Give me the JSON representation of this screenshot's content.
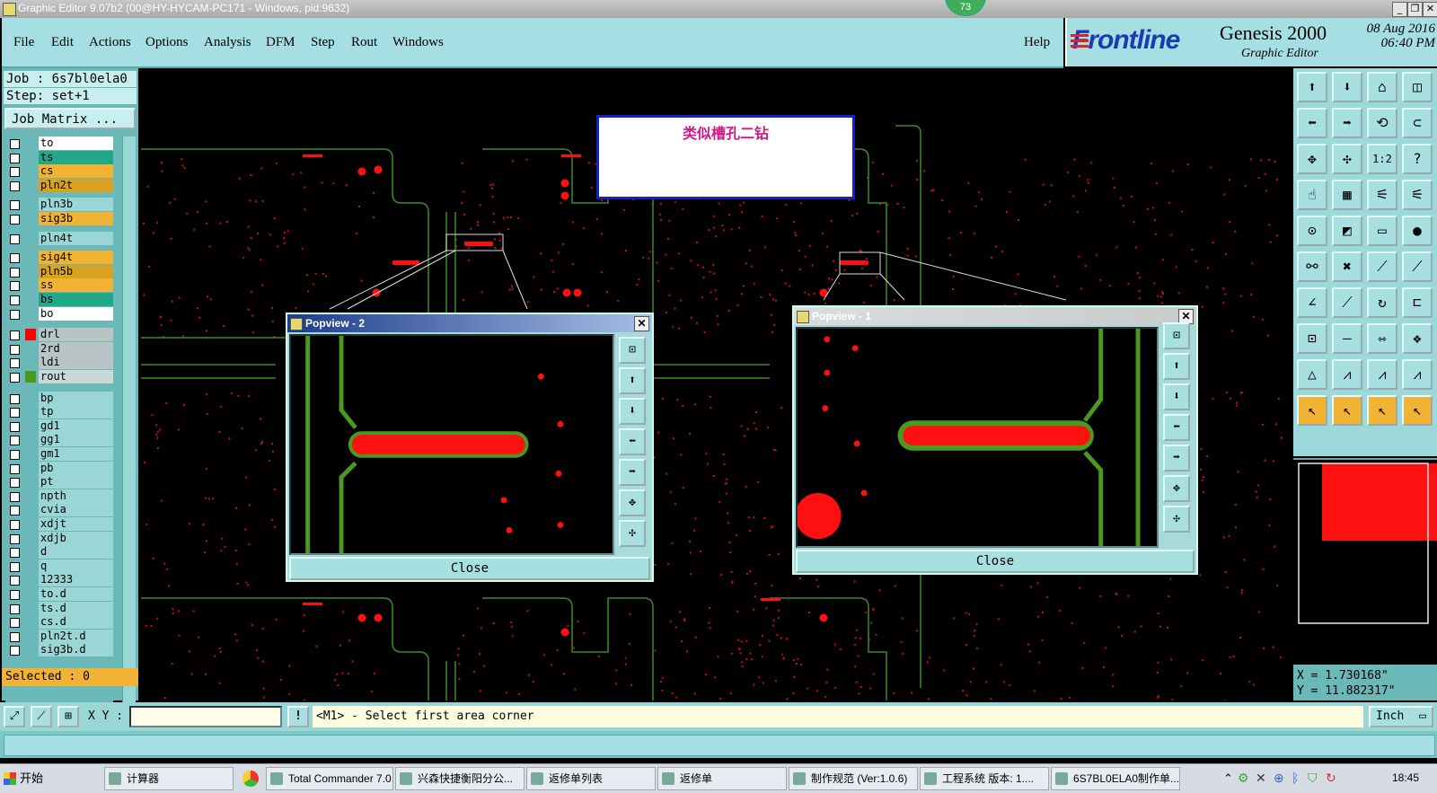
{
  "window": {
    "title": "Graphic Editor 9.07b2 (00@HY-HYCAM-PC171 - Windows, pid:9632)",
    "badge": "73"
  },
  "menu": [
    "File",
    "Edit",
    "Actions",
    "Options",
    "Analysis",
    "DFM",
    "Step",
    "Rout",
    "Windows"
  ],
  "help": "Help",
  "brand": {
    "logo": "Frontline",
    "product": "Genesis 2000",
    "subtitle": "Graphic Editor",
    "date": "08 Aug 2016",
    "time": "06:40 PM"
  },
  "job": {
    "job_label": "Job : 6s7bl0ela0",
    "step_label": "Step: set+1",
    "matrix_button": "Job Matrix ..."
  },
  "layers": [
    {
      "name": "to",
      "color": "#ffffff",
      "swatch": ""
    },
    {
      "name": "ts",
      "color": "#1fa88a",
      "swatch": ""
    },
    {
      "name": "cs",
      "color": "#f2b233",
      "swatch": ""
    },
    {
      "name": "pln2t",
      "color": "#d9a21e",
      "swatch": ""
    },
    {
      "name": "pln3b",
      "color": "#9ad6d6",
      "swatch": ""
    },
    {
      "name": "sig3b",
      "color": "#f2b233",
      "swatch": ""
    },
    {
      "name": "pln4t",
      "color": "#9ad6d6",
      "swatch": ""
    },
    {
      "name": "sig4t",
      "color": "#f2b233",
      "swatch": ""
    },
    {
      "name": "pln5b",
      "color": "#d9a21e",
      "swatch": ""
    },
    {
      "name": "ss",
      "color": "#f2b233",
      "swatch": ""
    },
    {
      "name": "bs",
      "color": "#1fa88a",
      "swatch": ""
    },
    {
      "name": "bo",
      "color": "#ffffff",
      "swatch": ""
    },
    {
      "name": "drl",
      "color": "#b9c4c4",
      "swatch": "#ff0000"
    },
    {
      "name": "2rd",
      "color": "#b9c4c4",
      "swatch": ""
    },
    {
      "name": "ldi",
      "color": "#b9c4c4",
      "swatch": ""
    },
    {
      "name": "rout",
      "color": "#c9d8d8",
      "swatch": "#4a9a20"
    },
    {
      "name": "bp",
      "color": "#9ad6d6",
      "swatch": ""
    },
    {
      "name": "tp",
      "color": "#9ad6d6",
      "swatch": ""
    },
    {
      "name": "gd1",
      "color": "#9ad6d6",
      "swatch": ""
    },
    {
      "name": "gg1",
      "color": "#9ad6d6",
      "swatch": ""
    },
    {
      "name": "gm1",
      "color": "#9ad6d6",
      "swatch": ""
    },
    {
      "name": "pb",
      "color": "#9ad6d6",
      "swatch": ""
    },
    {
      "name": "pt",
      "color": "#9ad6d6",
      "swatch": ""
    },
    {
      "name": "npth",
      "color": "#9ad6d6",
      "swatch": ""
    },
    {
      "name": "cvia",
      "color": "#9ad6d6",
      "swatch": ""
    },
    {
      "name": "xdjt",
      "color": "#9ad6d6",
      "swatch": ""
    },
    {
      "name": "xdjb",
      "color": "#9ad6d6",
      "swatch": ""
    },
    {
      "name": "d",
      "color": "#9ad6d6",
      "swatch": ""
    },
    {
      "name": "q",
      "color": "#9ad6d6",
      "swatch": ""
    },
    {
      "name": "12333",
      "color": "#9ad6d6",
      "swatch": ""
    },
    {
      "name": "to.d",
      "color": "#9ad6d6",
      "swatch": ""
    },
    {
      "name": "ts.d",
      "color": "#9ad6d6",
      "swatch": ""
    },
    {
      "name": "cs.d",
      "color": "#9ad6d6",
      "swatch": ""
    },
    {
      "name": "pln2t.d",
      "color": "#9ad6d6",
      "swatch": ""
    },
    {
      "name": "sig3b.d",
      "color": "#9ad6d6",
      "swatch": ""
    }
  ],
  "selected": "Selected : 0",
  "note": "类似槽孔二钻",
  "popview2": {
    "title": "Popview - 2",
    "close": "Close"
  },
  "popview1": {
    "title": "Popview - 1",
    "close": "Close"
  },
  "coords": {
    "x": "X = 1.730168\"",
    "y": "Y = 11.882317\""
  },
  "command": {
    "xy_label": "X Y :",
    "xy_value": "",
    "prompt": "<M1> - Select first area corner",
    "unit": "Inch"
  },
  "taskbar": {
    "start": "开始",
    "items": [
      "计算器",
      "Total Commander 7.0...",
      "兴森快捷衡阳分公...",
      "返修单列表",
      "返修单",
      "制作规范 (Ver:1.0.6)",
      "工程系统  版本: 1....",
      "6S7BL0ELA0制作单...."
    ],
    "clock": "18:45"
  }
}
